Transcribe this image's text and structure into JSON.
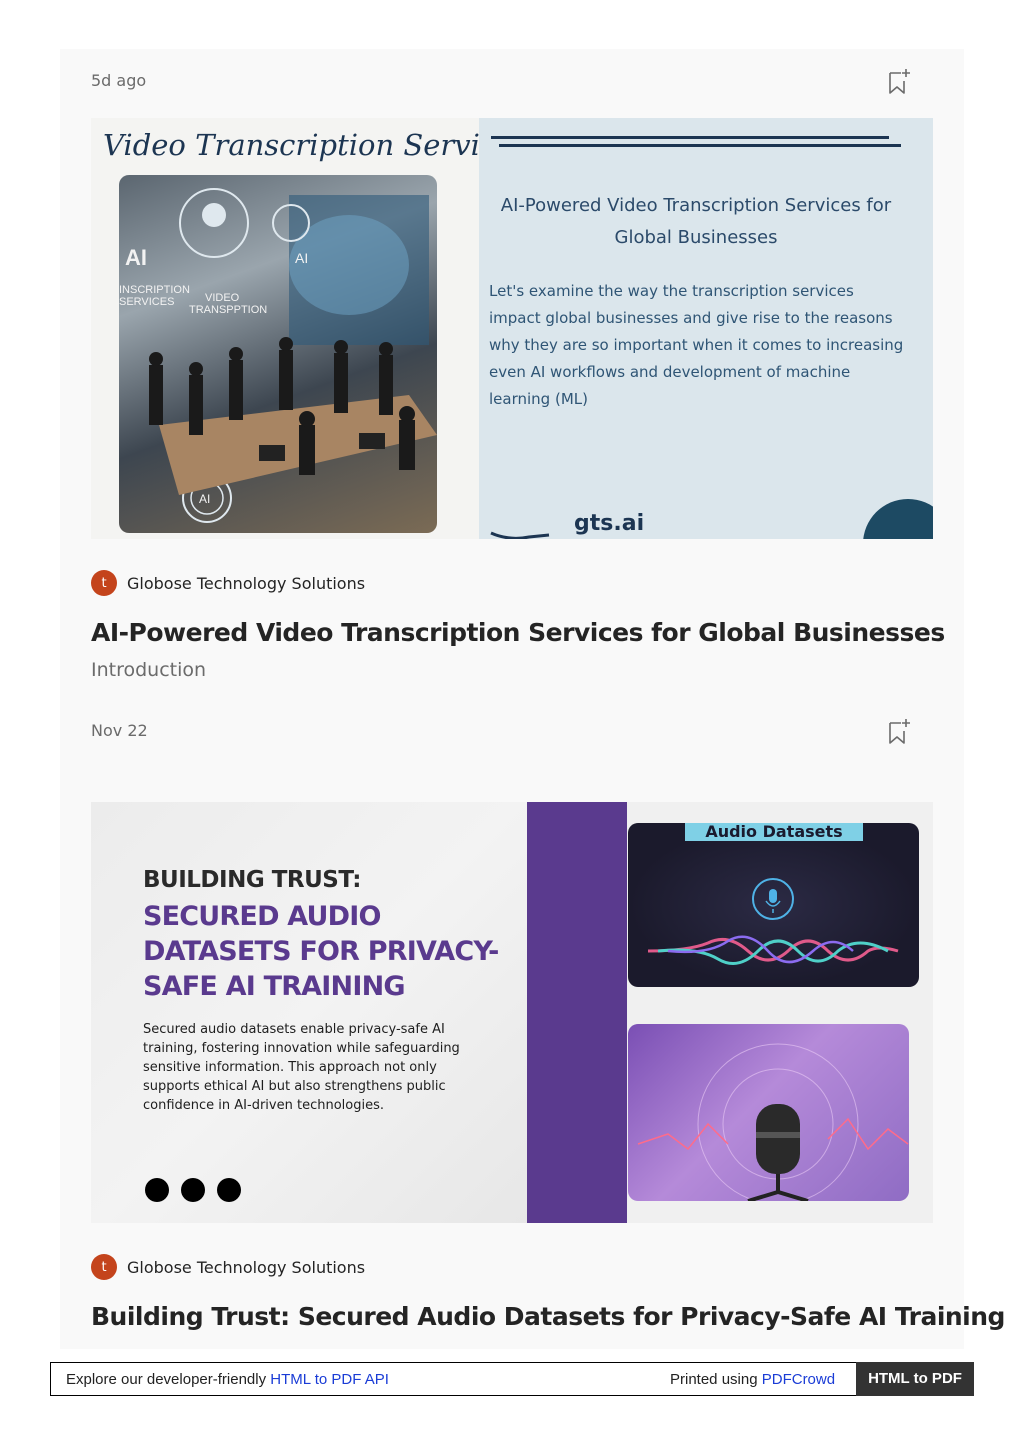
{
  "posts": [
    {
      "date": "5d ago",
      "publication": "Globose Technology Solutions",
      "avatar_letter": "t",
      "title": "AI-Powered Video Transcription Services for Global Businesses",
      "subtitle": "Introduction",
      "thumbnail": {
        "heading": "Video Transcription Services",
        "photo_labels": [
          "AI",
          "AI",
          "VIDEO",
          "TRANSPPTION",
          "INSCRIPTION SERVICES",
          "AI"
        ],
        "right_title": "AI-Powered Video Transcription Services for Global Businesses",
        "right_body": "Let's examine the way the transcription services impact global businesses and give rise to the reasons why they are so important when it comes to increasing even AI workflows and development of machine learning (ML)",
        "brand": "gts.ai"
      }
    },
    {
      "date": "Nov 22",
      "publication": "Globose Technology Solutions",
      "avatar_letter": "t",
      "title": "Building Trust: Secured Audio Datasets for Privacy-Safe AI Training",
      "thumbnail": {
        "heading_1": "BUILDING TRUST:",
        "heading_2": "SECURED AUDIO DATASETS FOR PRIVACY-SAFE AI TRAINING",
        "body": "Secured audio datasets enable privacy-safe AI training, fostering innovation while safeguarding sensitive information. This approach not only supports ethical AI but also strengthens public confidence in AI-driven technologies.",
        "tag": "Audio Datasets"
      }
    }
  ],
  "footer": {
    "explore_text": "Explore our developer-friendly ",
    "explore_link": "HTML to PDF API",
    "printed_text": "Printed using ",
    "printed_link": "PDFCrowd",
    "button": "HTML to PDF"
  },
  "colors": {
    "accent_purple": "#5a3a8e",
    "avatar": "#c4441c",
    "navy": "#1c3552"
  }
}
